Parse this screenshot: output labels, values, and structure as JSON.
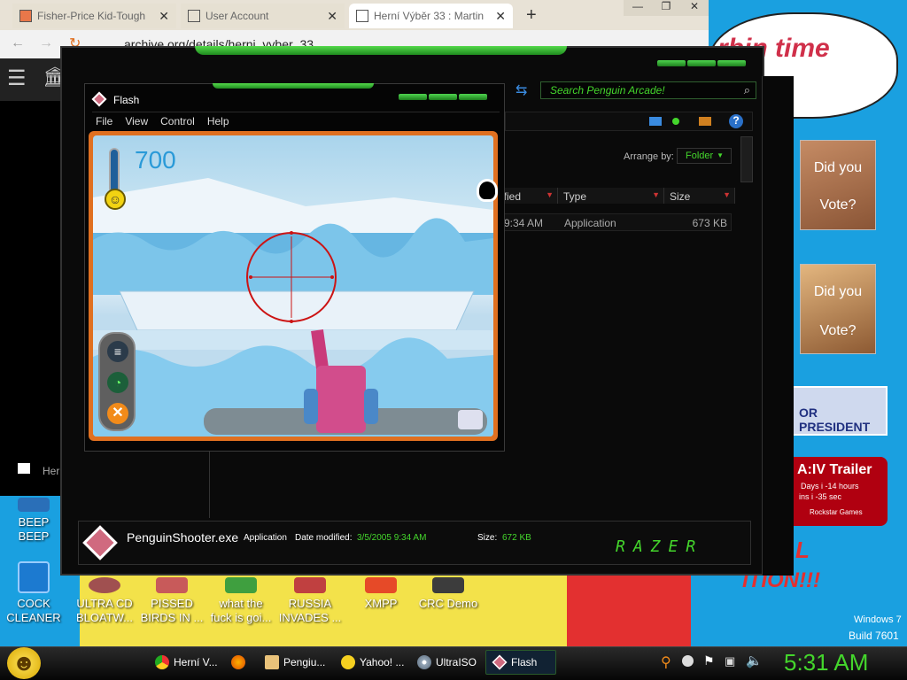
{
  "browser": {
    "tabs": [
      {
        "label": "Fisher-Price Kid-Tough",
        "color": "#e8774a"
      },
      {
        "label": "User Account",
        "color": "#666666"
      },
      {
        "label": "Herní Výběr 33 : Martin",
        "color": "#666666"
      }
    ],
    "new_tab": "+",
    "url": "archive.org/details/herni_vyber_33",
    "sidebar_tab_label": "Her"
  },
  "bg_text": {
    "top": "rbin time",
    "president": "OR PRESIDENT",
    "trailer": "A:IV Trailer",
    "trailer_line1": "Days  i  -14 hours",
    "trailer_line2": "ins  i  -35 sec",
    "trailer_line3": "Rockstar Games",
    "edition": "L",
    "edition2": "ITION!!!",
    "poll_q1": "Did you",
    "poll_a1": "Vote?",
    "poll_q2": "Did you",
    "poll_a2": "Vote?"
  },
  "explorer": {
    "search_placeholder": "Search Penguin Arcade!",
    "arrange_label": "Arrange by:",
    "arrange_value": "Folder",
    "columns": [
      "ified",
      "Type",
      "Size"
    ],
    "row": {
      "date": "9:34 AM",
      "type": "Application",
      "size": "673 KB"
    },
    "details": {
      "filename": "PenguinShooter.exe",
      "kind": "Application",
      "date_label": "Date modified:",
      "date_value": "3/5/2005 9:34 AM",
      "size_label": "Size:",
      "size_value": "672 KB"
    },
    "brand": "RAZER"
  },
  "flash": {
    "title": "Flash",
    "menu": [
      "File",
      "View",
      "Control",
      "Help"
    ],
    "game": {
      "score": "700",
      "crosshair_dots": 4
    }
  },
  "desktop_icons": [
    {
      "label": "BEEP\nBEEP",
      "line1": "BEEP",
      "line2": "BEEP"
    },
    {
      "line1": "COCK",
      "line2": "CLEANER"
    },
    {
      "line1": "ULTRA CD",
      "line2": "BLOATW..."
    },
    {
      "line1": "PISSED",
      "line2": "BIRDS IN ..."
    },
    {
      "line1": "what the",
      "line2": "fuck is goi..."
    },
    {
      "line1": "RUSSIA",
      "line2": "INVADES ..."
    },
    {
      "line1": "XMPP",
      "line2": ""
    },
    {
      "line1": "CRC Demo",
      "line2": ""
    }
  ],
  "windows_watermark": {
    "line1": "Windows 7",
    "line2": "Build 7601"
  },
  "taskbar": {
    "items": [
      "Herní V...",
      "",
      "Pengiu...",
      "Yahoo! ...",
      "UltraISO",
      "Flash"
    ],
    "clock": "5:31 AM"
  },
  "colors": {
    "razer_green": "#44d62c",
    "title_black": "#000000",
    "game_orange": "#e07020",
    "score_blue": "#2a9ad8"
  }
}
